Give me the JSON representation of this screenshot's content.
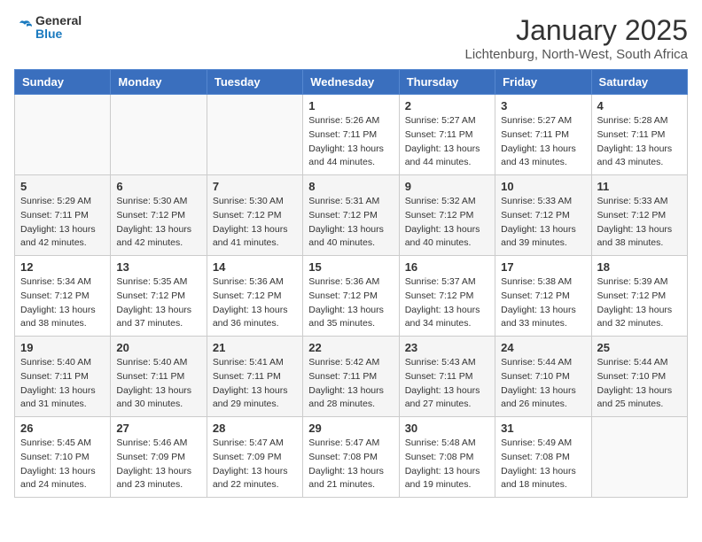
{
  "logo": {
    "general": "General",
    "blue": "Blue"
  },
  "title": "January 2025",
  "subtitle": "Lichtenburg, North-West, South Africa",
  "days_header": [
    "Sunday",
    "Monday",
    "Tuesday",
    "Wednesday",
    "Thursday",
    "Friday",
    "Saturday"
  ],
  "weeks": [
    [
      {
        "day": "",
        "sunrise": "",
        "sunset": "",
        "daylight": ""
      },
      {
        "day": "",
        "sunrise": "",
        "sunset": "",
        "daylight": ""
      },
      {
        "day": "",
        "sunrise": "",
        "sunset": "",
        "daylight": ""
      },
      {
        "day": "1",
        "sunrise": "Sunrise: 5:26 AM",
        "sunset": "Sunset: 7:11 PM",
        "daylight": "Daylight: 13 hours and 44 minutes."
      },
      {
        "day": "2",
        "sunrise": "Sunrise: 5:27 AM",
        "sunset": "Sunset: 7:11 PM",
        "daylight": "Daylight: 13 hours and 44 minutes."
      },
      {
        "day": "3",
        "sunrise": "Sunrise: 5:27 AM",
        "sunset": "Sunset: 7:11 PM",
        "daylight": "Daylight: 13 hours and 43 minutes."
      },
      {
        "day": "4",
        "sunrise": "Sunrise: 5:28 AM",
        "sunset": "Sunset: 7:11 PM",
        "daylight": "Daylight: 13 hours and 43 minutes."
      }
    ],
    [
      {
        "day": "5",
        "sunrise": "Sunrise: 5:29 AM",
        "sunset": "Sunset: 7:11 PM",
        "daylight": "Daylight: 13 hours and 42 minutes."
      },
      {
        "day": "6",
        "sunrise": "Sunrise: 5:30 AM",
        "sunset": "Sunset: 7:12 PM",
        "daylight": "Daylight: 13 hours and 42 minutes."
      },
      {
        "day": "7",
        "sunrise": "Sunrise: 5:30 AM",
        "sunset": "Sunset: 7:12 PM",
        "daylight": "Daylight: 13 hours and 41 minutes."
      },
      {
        "day": "8",
        "sunrise": "Sunrise: 5:31 AM",
        "sunset": "Sunset: 7:12 PM",
        "daylight": "Daylight: 13 hours and 40 minutes."
      },
      {
        "day": "9",
        "sunrise": "Sunrise: 5:32 AM",
        "sunset": "Sunset: 7:12 PM",
        "daylight": "Daylight: 13 hours and 40 minutes."
      },
      {
        "day": "10",
        "sunrise": "Sunrise: 5:33 AM",
        "sunset": "Sunset: 7:12 PM",
        "daylight": "Daylight: 13 hours and 39 minutes."
      },
      {
        "day": "11",
        "sunrise": "Sunrise: 5:33 AM",
        "sunset": "Sunset: 7:12 PM",
        "daylight": "Daylight: 13 hours and 38 minutes."
      }
    ],
    [
      {
        "day": "12",
        "sunrise": "Sunrise: 5:34 AM",
        "sunset": "Sunset: 7:12 PM",
        "daylight": "Daylight: 13 hours and 38 minutes."
      },
      {
        "day": "13",
        "sunrise": "Sunrise: 5:35 AM",
        "sunset": "Sunset: 7:12 PM",
        "daylight": "Daylight: 13 hours and 37 minutes."
      },
      {
        "day": "14",
        "sunrise": "Sunrise: 5:36 AM",
        "sunset": "Sunset: 7:12 PM",
        "daylight": "Daylight: 13 hours and 36 minutes."
      },
      {
        "day": "15",
        "sunrise": "Sunrise: 5:36 AM",
        "sunset": "Sunset: 7:12 PM",
        "daylight": "Daylight: 13 hours and 35 minutes."
      },
      {
        "day": "16",
        "sunrise": "Sunrise: 5:37 AM",
        "sunset": "Sunset: 7:12 PM",
        "daylight": "Daylight: 13 hours and 34 minutes."
      },
      {
        "day": "17",
        "sunrise": "Sunrise: 5:38 AM",
        "sunset": "Sunset: 7:12 PM",
        "daylight": "Daylight: 13 hours and 33 minutes."
      },
      {
        "day": "18",
        "sunrise": "Sunrise: 5:39 AM",
        "sunset": "Sunset: 7:12 PM",
        "daylight": "Daylight: 13 hours and 32 minutes."
      }
    ],
    [
      {
        "day": "19",
        "sunrise": "Sunrise: 5:40 AM",
        "sunset": "Sunset: 7:11 PM",
        "daylight": "Daylight: 13 hours and 31 minutes."
      },
      {
        "day": "20",
        "sunrise": "Sunrise: 5:40 AM",
        "sunset": "Sunset: 7:11 PM",
        "daylight": "Daylight: 13 hours and 30 minutes."
      },
      {
        "day": "21",
        "sunrise": "Sunrise: 5:41 AM",
        "sunset": "Sunset: 7:11 PM",
        "daylight": "Daylight: 13 hours and 29 minutes."
      },
      {
        "day": "22",
        "sunrise": "Sunrise: 5:42 AM",
        "sunset": "Sunset: 7:11 PM",
        "daylight": "Daylight: 13 hours and 28 minutes."
      },
      {
        "day": "23",
        "sunrise": "Sunrise: 5:43 AM",
        "sunset": "Sunset: 7:11 PM",
        "daylight": "Daylight: 13 hours and 27 minutes."
      },
      {
        "day": "24",
        "sunrise": "Sunrise: 5:44 AM",
        "sunset": "Sunset: 7:10 PM",
        "daylight": "Daylight: 13 hours and 26 minutes."
      },
      {
        "day": "25",
        "sunrise": "Sunrise: 5:44 AM",
        "sunset": "Sunset: 7:10 PM",
        "daylight": "Daylight: 13 hours and 25 minutes."
      }
    ],
    [
      {
        "day": "26",
        "sunrise": "Sunrise: 5:45 AM",
        "sunset": "Sunset: 7:10 PM",
        "daylight": "Daylight: 13 hours and 24 minutes."
      },
      {
        "day": "27",
        "sunrise": "Sunrise: 5:46 AM",
        "sunset": "Sunset: 7:09 PM",
        "daylight": "Daylight: 13 hours and 23 minutes."
      },
      {
        "day": "28",
        "sunrise": "Sunrise: 5:47 AM",
        "sunset": "Sunset: 7:09 PM",
        "daylight": "Daylight: 13 hours and 22 minutes."
      },
      {
        "day": "29",
        "sunrise": "Sunrise: 5:47 AM",
        "sunset": "Sunset: 7:08 PM",
        "daylight": "Daylight: 13 hours and 21 minutes."
      },
      {
        "day": "30",
        "sunrise": "Sunrise: 5:48 AM",
        "sunset": "Sunset: 7:08 PM",
        "daylight": "Daylight: 13 hours and 19 minutes."
      },
      {
        "day": "31",
        "sunrise": "Sunrise: 5:49 AM",
        "sunset": "Sunset: 7:08 PM",
        "daylight": "Daylight: 13 hours and 18 minutes."
      },
      {
        "day": "",
        "sunrise": "",
        "sunset": "",
        "daylight": ""
      }
    ]
  ]
}
